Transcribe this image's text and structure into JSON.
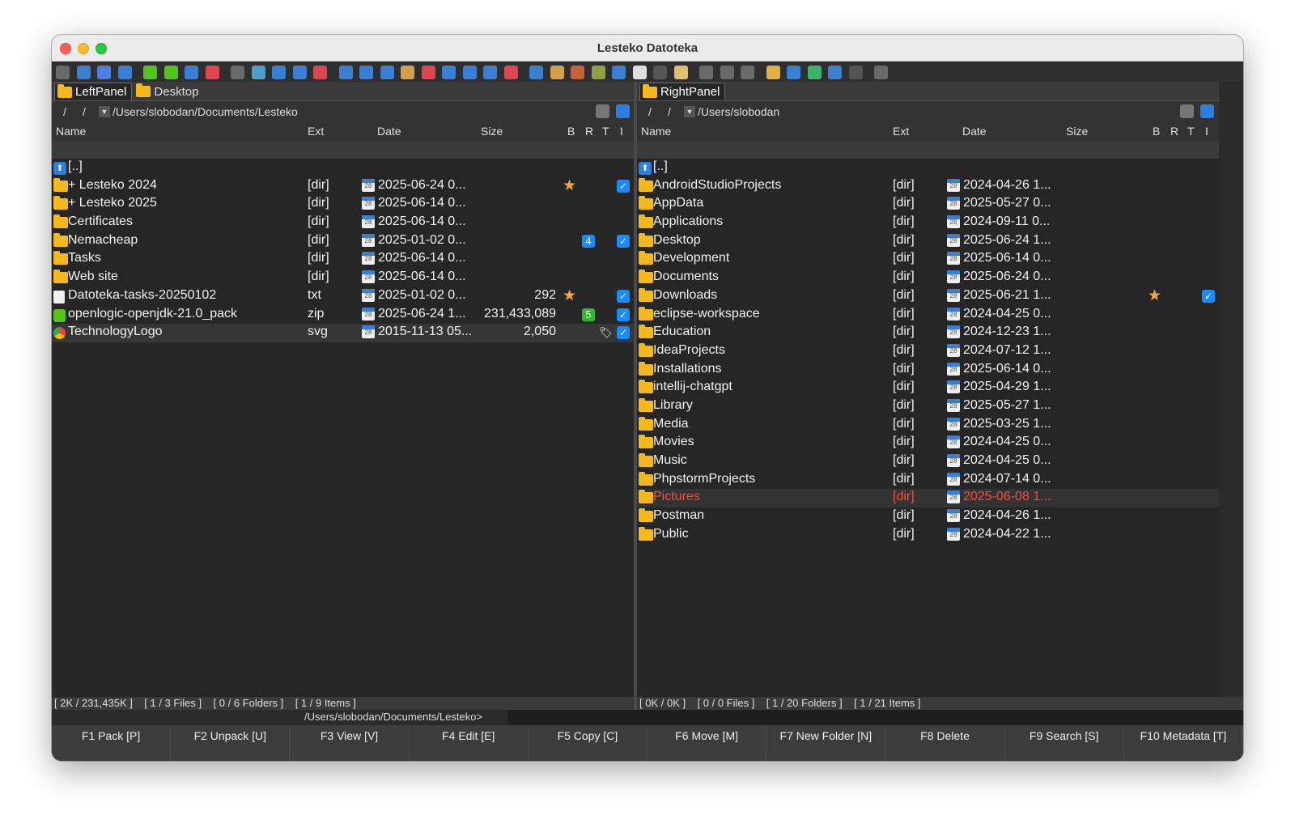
{
  "window": {
    "title": "Lesteko Datoteka"
  },
  "toolbar_colors": [
    "#6a6a6a",
    "#3b7fd4",
    "#4a7ee0",
    "#3b7fd4",
    "#52c41a",
    "#52c41a",
    "#3b7fd4",
    "#e0444e",
    "#6a6a6a",
    "#4aa0c8",
    "#3b7fd4",
    "#3b7fd4",
    "#e0444e",
    "#3b7fd4",
    "#3b7fd4",
    "#3b7fd4",
    "#d4a04a",
    "#e0444e",
    "#3b7fd4",
    "#3b7fd4",
    "#3b7fd4",
    "#e0444e",
    "#3b7fd4",
    "#d4a04a",
    "#c8603a",
    "#8fa040",
    "#3b7fd4",
    "#dddddd",
    "#555555",
    "#e0c070",
    "#6a6a6a",
    "#6a6a6a",
    "#6a6a6a",
    "#e0b040",
    "#3b7fd4",
    "#3bb56a",
    "#3b7fd4",
    "#555555",
    "#6a6a6a"
  ],
  "left": {
    "tabs": [
      {
        "label": "LeftPanel",
        "active": true
      },
      {
        "label": "Desktop",
        "active": false
      }
    ],
    "path": "/Users/slobodan/Documents/Lesteko",
    "columns": {
      "name": "Name",
      "ext": "Ext",
      "date": "Date",
      "size": "Size",
      "b": "B",
      "r": "R",
      "t": "T",
      "i": "I"
    },
    "rows": [
      {
        "icon": "up",
        "name": "[..]",
        "ext": "",
        "date": "",
        "size": ""
      },
      {
        "icon": "folder",
        "name": "+ Lesteko 2024",
        "ext": "[dir]",
        "date": "2025-06-24 0...",
        "size": "",
        "b": "star",
        "i": "check"
      },
      {
        "icon": "folder",
        "name": "+ Lesteko 2025",
        "ext": "[dir]",
        "date": "2025-06-14 0...",
        "size": ""
      },
      {
        "icon": "folder",
        "name": "Certificates",
        "ext": "[dir]",
        "date": "2025-06-14 0...",
        "size": ""
      },
      {
        "icon": "folder",
        "name": "Nemacheap",
        "ext": "[dir]",
        "date": "2025-01-02 0...",
        "size": "",
        "r": "4",
        "i": "check"
      },
      {
        "icon": "folder",
        "name": "Tasks",
        "ext": "[dir]",
        "date": "2025-06-14 0...",
        "size": ""
      },
      {
        "icon": "folder",
        "name": "Web site",
        "ext": "[dir]",
        "date": "2025-06-14 0...",
        "size": ""
      },
      {
        "icon": "file",
        "name": "Datoteka-tasks-20250102",
        "ext": "txt",
        "date": "2025-01-02 0...",
        "size": "292",
        "b": "star",
        "i": "check"
      },
      {
        "icon": "zip",
        "name": "openlogic-openjdk-21.0_pack",
        "ext": "zip",
        "date": "2025-06-24 1...",
        "size": "231,433,089",
        "r": "5",
        "i": "check"
      },
      {
        "icon": "svg",
        "name": "TechnologyLogo",
        "ext": "svg",
        "date": "2015-11-13 05...",
        "size": "2,050",
        "t": "tag",
        "i": "check",
        "selected": true
      }
    ],
    "status": "[ 2K / 231,435K ]    [ 1 / 3 Files ]    [ 0 / 6 Folders ]    [ 1 / 9 Items ]"
  },
  "right": {
    "tabs": [
      {
        "label": "RightPanel",
        "active": true
      }
    ],
    "path": "/Users/slobodan",
    "columns": {
      "name": "Name",
      "ext": "Ext",
      "date": "Date",
      "size": "Size",
      "b": "B",
      "r": "R",
      "t": "T",
      "i": "I"
    },
    "rows": [
      {
        "icon": "up",
        "name": "[..]",
        "ext": "",
        "date": ""
      },
      {
        "icon": "folder",
        "name": "AndroidStudioProjects",
        "ext": "[dir]",
        "date": "2024-04-26 1..."
      },
      {
        "icon": "folder",
        "name": "AppData",
        "ext": "[dir]",
        "date": "2025-05-27 0..."
      },
      {
        "icon": "folder",
        "name": "Applications",
        "ext": "[dir]",
        "date": "2024-09-11 0..."
      },
      {
        "icon": "folder",
        "name": "Desktop",
        "ext": "[dir]",
        "date": "2025-06-24 1..."
      },
      {
        "icon": "folder",
        "name": "Development",
        "ext": "[dir]",
        "date": "2025-06-14 0..."
      },
      {
        "icon": "folder",
        "name": "Documents",
        "ext": "[dir]",
        "date": "2025-06-24 0..."
      },
      {
        "icon": "folder",
        "name": "Downloads",
        "ext": "[dir]",
        "date": "2025-06-21 1...",
        "b": "star",
        "i": "check"
      },
      {
        "icon": "folder",
        "name": "eclipse-workspace",
        "ext": "[dir]",
        "date": "2024-04-25 0..."
      },
      {
        "icon": "folder",
        "name": "Education",
        "ext": "[dir]",
        "date": "2024-12-23 1..."
      },
      {
        "icon": "folder",
        "name": "IdeaProjects",
        "ext": "[dir]",
        "date": "2024-07-12 1..."
      },
      {
        "icon": "folder",
        "name": "Installations",
        "ext": "[dir]",
        "date": "2025-06-14 0..."
      },
      {
        "icon": "folder",
        "name": "intellij-chatgpt",
        "ext": "[dir]",
        "date": "2025-04-29 1..."
      },
      {
        "icon": "folder",
        "name": "Library",
        "ext": "[dir]",
        "date": "2025-05-27 1..."
      },
      {
        "icon": "folder",
        "name": "Media",
        "ext": "[dir]",
        "date": "2025-03-25 1..."
      },
      {
        "icon": "folder",
        "name": "Movies",
        "ext": "[dir]",
        "date": "2024-04-25 0..."
      },
      {
        "icon": "folder",
        "name": "Music",
        "ext": "[dir]",
        "date": "2024-04-25 0..."
      },
      {
        "icon": "folder",
        "name": "PhpstormProjects",
        "ext": "[dir]",
        "date": "2024-07-14 0..."
      },
      {
        "icon": "folder",
        "name": "Pictures",
        "ext": "[dir]",
        "date": "2025-06-08 1...",
        "highlight": true
      },
      {
        "icon": "folder",
        "name": "Postman",
        "ext": "[dir]",
        "date": "2024-04-26 1..."
      },
      {
        "icon": "folder",
        "name": "Public",
        "ext": "[dir]",
        "date": "2024-04-22 1..."
      }
    ],
    "status": "[ 0K / 0K ]    [ 0 / 0 Files ]    [ 1 / 20 Folders ]    [ 1 / 21 Items ]"
  },
  "command": {
    "prompt": "/Users/slobodan/Documents/Lesteko>",
    "value": ""
  },
  "fkeys": [
    "F1 Pack [P]",
    "F2 Unpack [U]",
    "F3 View [V]",
    "F4 Edit [E]",
    "F5 Copy [C]",
    "F6 Move [M]",
    "F7 New Folder [N]",
    "F8 Delete",
    "F9 Search [S]",
    "F10 Metadata [T]"
  ],
  "colors": {
    "selected_text": "#ff4b3e",
    "folder": "#f5b81d",
    "star": "#f3a73b",
    "check": "#1a8cff",
    "badge_blue": "#1a8cff",
    "badge_green": "#2db82d"
  },
  "icons": {
    "up": "up-arrow-icon",
    "folder": "folder-icon",
    "file": "text-file-icon",
    "zip": "zip-file-icon",
    "svg": "svg-file-icon",
    "date": "calendar-icon",
    "b": "star-icon",
    "i": "check-icon",
    "t": "tag-icon"
  }
}
